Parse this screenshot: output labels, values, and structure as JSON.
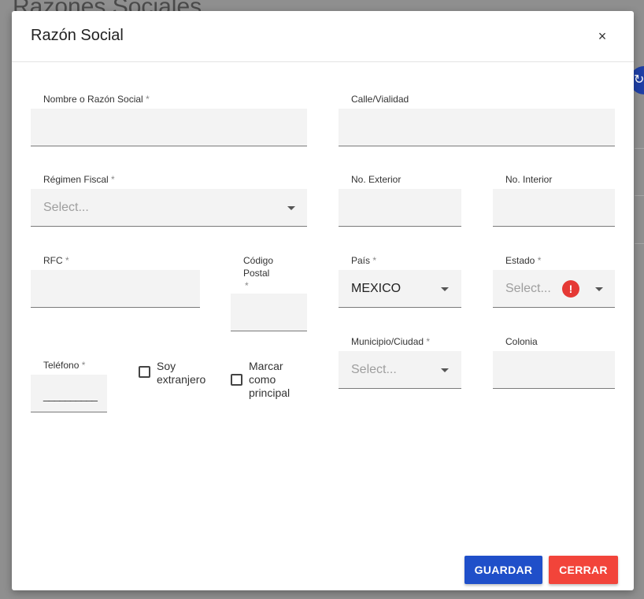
{
  "background": {
    "page_title": "Razones Sociales"
  },
  "modal": {
    "title": "Razón Social",
    "close_icon": "×",
    "required_mark": "*",
    "fields": {
      "nombre": {
        "label": "Nombre o Razón Social",
        "value": ""
      },
      "calle": {
        "label": "Calle/Vialidad",
        "value": ""
      },
      "regimen": {
        "label": "Régimen Fiscal",
        "placeholder": "Select..."
      },
      "no_exterior": {
        "label": "No. Exterior",
        "value": ""
      },
      "no_interior": {
        "label": "No. Interior",
        "value": ""
      },
      "rfc": {
        "label": "RFC",
        "value": ""
      },
      "codigo_postal": {
        "label_line1": "Código",
        "label_line2": "Postal",
        "value": ""
      },
      "pais": {
        "label": "País",
        "value": "MEXICO"
      },
      "estado": {
        "label": "Estado",
        "placeholder": "Select...",
        "error_icon": "!"
      },
      "telefono": {
        "label": "Teléfono",
        "mask": "__________"
      },
      "soy_extranjero": {
        "label_line1": "Soy",
        "label_line2": "extranjero",
        "checked": false
      },
      "principal": {
        "label_line1": "Marcar",
        "label_line2": "como",
        "label_line3": "principal",
        "checked": false
      },
      "municipio": {
        "label": "Municipio/Ciudad",
        "placeholder": "Select..."
      },
      "colonia": {
        "label": "Colonia",
        "value": ""
      }
    },
    "buttons": {
      "save": "GUARDAR",
      "close": "CERRAR"
    }
  },
  "colors": {
    "save_button": "#1f4fc9",
    "close_button": "#f2443a",
    "error": "#e53935",
    "field_bg": "#f3f3f3"
  }
}
